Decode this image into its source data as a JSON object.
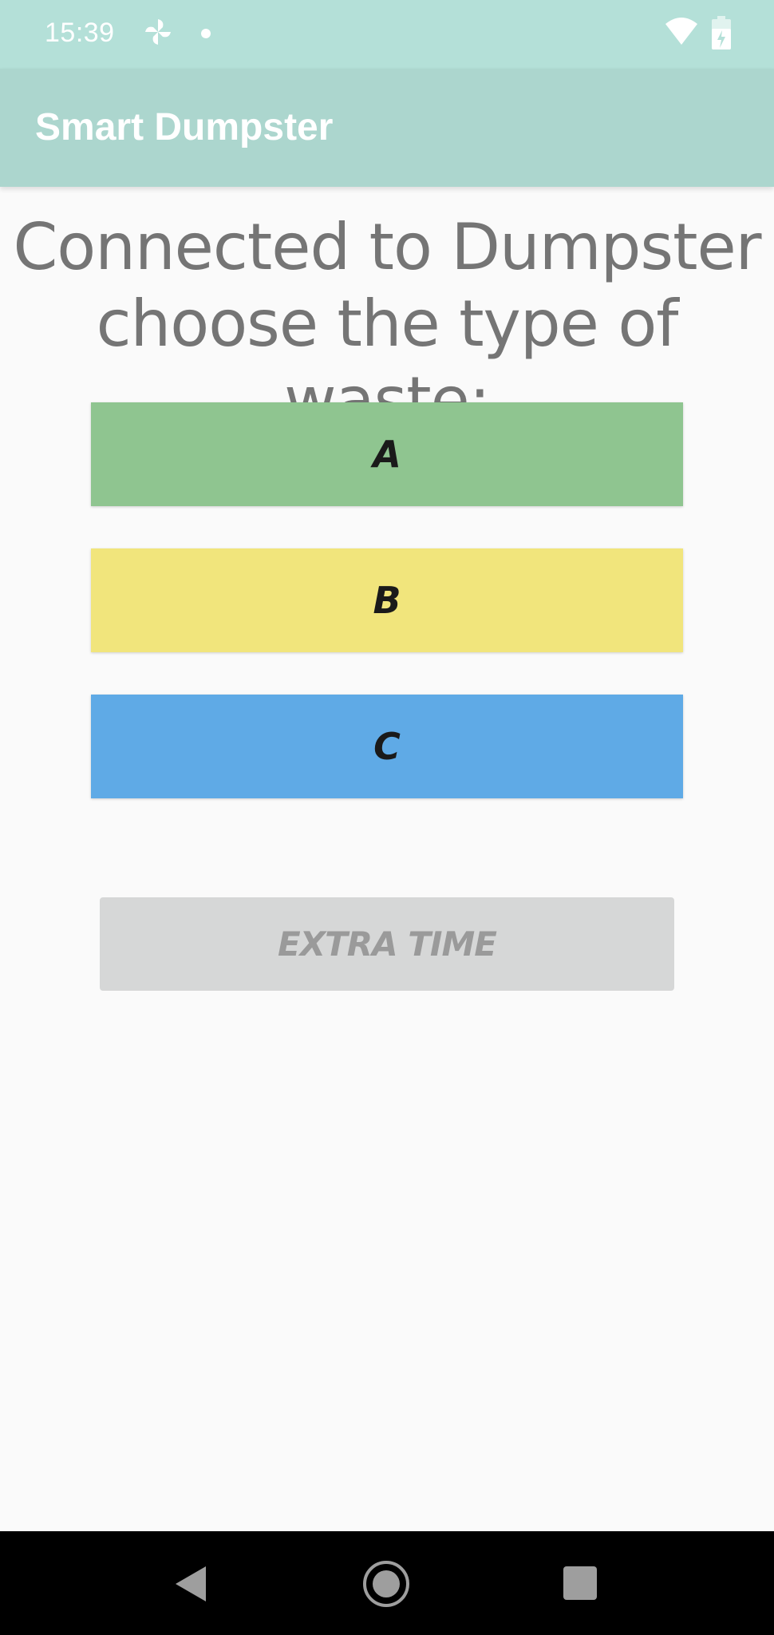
{
  "status_bar": {
    "time": "15:39"
  },
  "app_bar": {
    "title": "Smart Dumpster"
  },
  "main": {
    "heading_line1": "Connected to Dumpster",
    "heading_line2": "choose the type of waste:",
    "waste_buttons": [
      {
        "label": "A",
        "color": "#8fc590"
      },
      {
        "label": "B",
        "color": "#f1e57c"
      },
      {
        "label": "C",
        "color": "#5faae6"
      }
    ],
    "extra_time_label": "EXTRA TIME"
  },
  "colors": {
    "status_bar": "#b4e0d8",
    "app_bar": "#acd6ce",
    "background": "#fafafa",
    "heading_text": "#757575",
    "extra_time_bg": "#d6d7d7",
    "extra_time_text": "#9a9a9a"
  },
  "nav_bar": {
    "icons": [
      "back-icon",
      "home-icon",
      "recents-icon"
    ]
  }
}
